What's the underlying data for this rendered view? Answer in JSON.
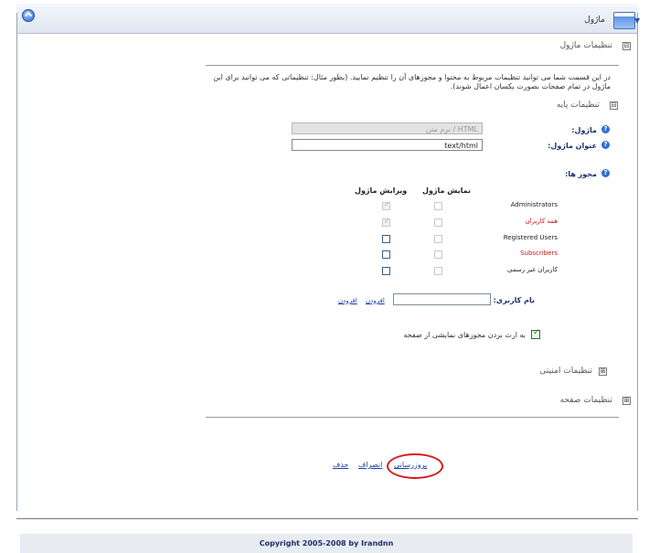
{
  "window": {
    "title": "ماژول",
    "icons": [
      "collapse-icon",
      "module-icon",
      "dropdown-arrow-icon"
    ]
  },
  "sections": {
    "module_settings": {
      "toggle": "⊟",
      "title": "تنظیمات ماژول"
    },
    "description": "در این قسمت شما می توانید تنظیمات مربوط به محتوا و مجوزهای آن را تنظیم نمایید. (بطور مثال: تنظیماتی که می توانید برای این ماژول در تمام صفحات بصورت یکسان اعمال شوند).",
    "base_settings": {
      "toggle": "⊟",
      "title": "تنظیمات پایه"
    },
    "security_settings": {
      "toggle": "⊞",
      "title": "تنظیمات امنیتی"
    },
    "page_settings": {
      "toggle": "⊞",
      "title": "تنظیمات صفحه"
    }
  },
  "form": {
    "module_label": "ماژول:",
    "module_value": "نرم متن / HTML",
    "module_title_label": "عنوان ماژول:",
    "module_title_value": "text/html",
    "permissions_label": "مجوز ها:",
    "col_view": "نمایش ماژول",
    "col_edit": "ویرایش ماژول",
    "roles": [
      {
        "name": "Administrators",
        "red": false,
        "view": "checked-grey",
        "edit": "light"
      },
      {
        "name": "همه کاربران",
        "red": true,
        "view": "checked-grey",
        "edit": "light"
      },
      {
        "name": "Registered Users",
        "red": false,
        "view": "dark",
        "edit": "light"
      },
      {
        "name": "Subscribers",
        "red": true,
        "view": "dark",
        "edit": "light"
      },
      {
        "name": "کاربران غیر رسمی",
        "red": false,
        "view": "dark",
        "edit": "light"
      }
    ],
    "username_label": "نام کاربری:",
    "username_value": "",
    "add_link": "افزودن",
    "inherit_label": "به ارث بردن مجوزهای نمایشی از صفحه",
    "inherit_checked": true
  },
  "actions": {
    "update_label": "بروزرسانی",
    "cancel_label": "انصراف",
    "delete_label": "حذف"
  },
  "footer": {
    "text": "Copyright 2005-2008 by Irandnn"
  },
  "colors": {
    "accent": "#2f6fd1",
    "required_role": "#d01010",
    "annotation_circle": "#d81818"
  }
}
